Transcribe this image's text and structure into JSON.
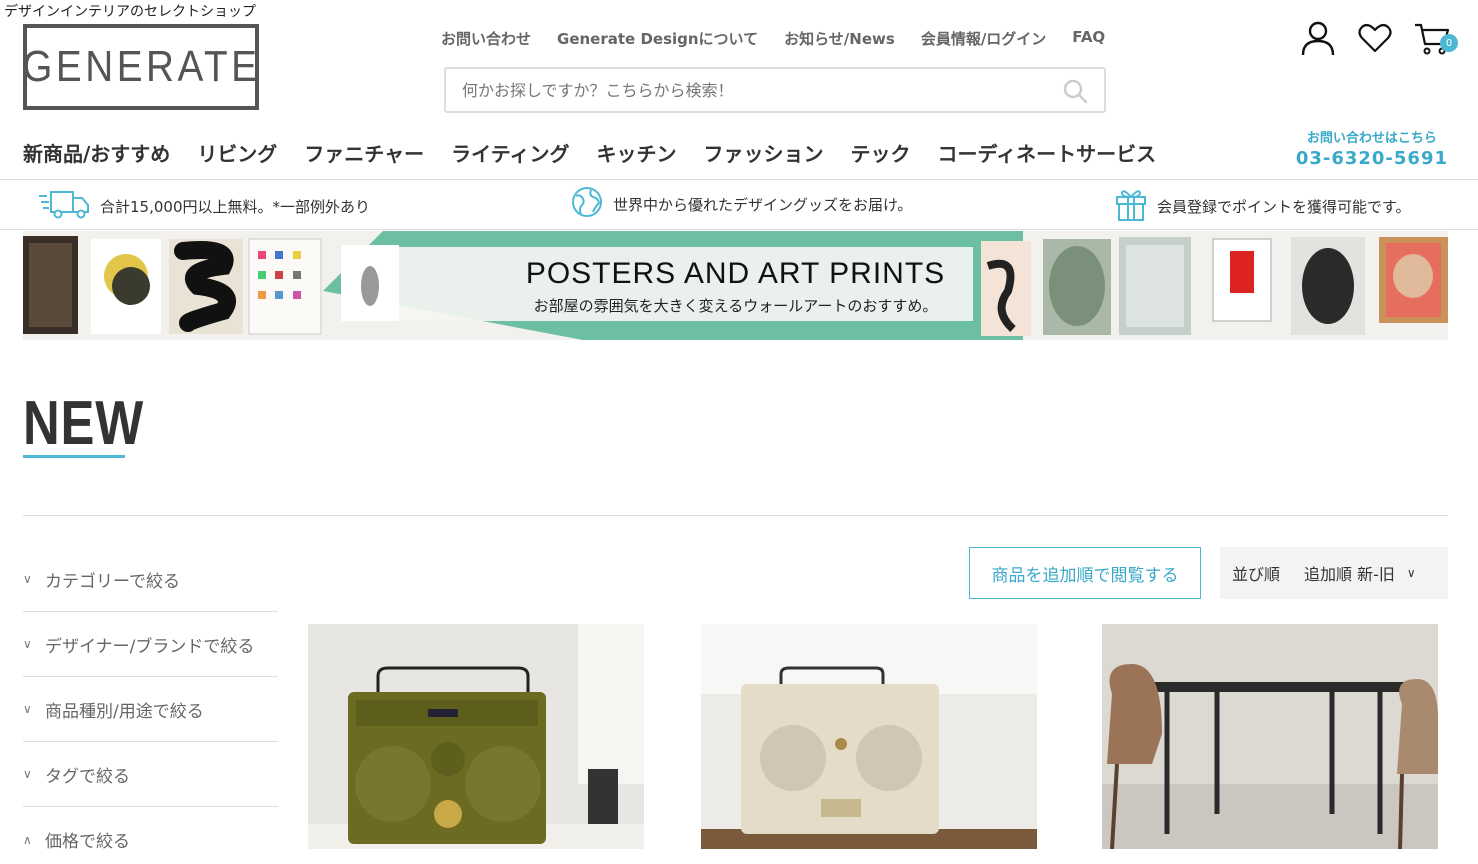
{
  "header": {
    "tagline": "デザインインテリアのセレクトショップ",
    "logo": "GENERATE",
    "top_nav": [
      "お問い合わせ",
      "Generate Designについて",
      "お知らせ/News",
      "会員情報/ログイン",
      "FAQ"
    ],
    "search_placeholder": "何かお探しですか？こちらから検索！",
    "cart_count": "0",
    "category_nav": [
      "新商品/おすすめ",
      "リビング",
      "ファニチャー",
      "ライティング",
      "キッチン",
      "ファッション",
      "テック",
      "コーディネートサービス"
    ],
    "contact_label": "お問い合わせはこちら",
    "contact_phone": "03-6320-5691"
  },
  "infobar": {
    "shipping": "合計15,000円以上無料。*一部例外あり",
    "global": "世界中から優れたデザイングッズをお届け。",
    "points": "会員登録でポイントを獲得可能です。"
  },
  "banner": {
    "title": "POSTERS AND ART PRINTS",
    "subtitle": "お部屋の雰囲気を大きく変えるウォールアートのおすすめ。"
  },
  "section": {
    "heading": "NEW"
  },
  "filters": [
    "カテゴリーで絞る",
    "デザイナー/ブランドで絞る",
    "商品種別/用途で絞る",
    "タグで絞る",
    "価格で絞る"
  ],
  "sort": {
    "browse_button": "商品を追加順で閲覧する",
    "label": "並び順",
    "value": "追加順 新-旧"
  },
  "colors": {
    "accent": "#4db8d4",
    "banner_green": "#6dbfa3"
  }
}
